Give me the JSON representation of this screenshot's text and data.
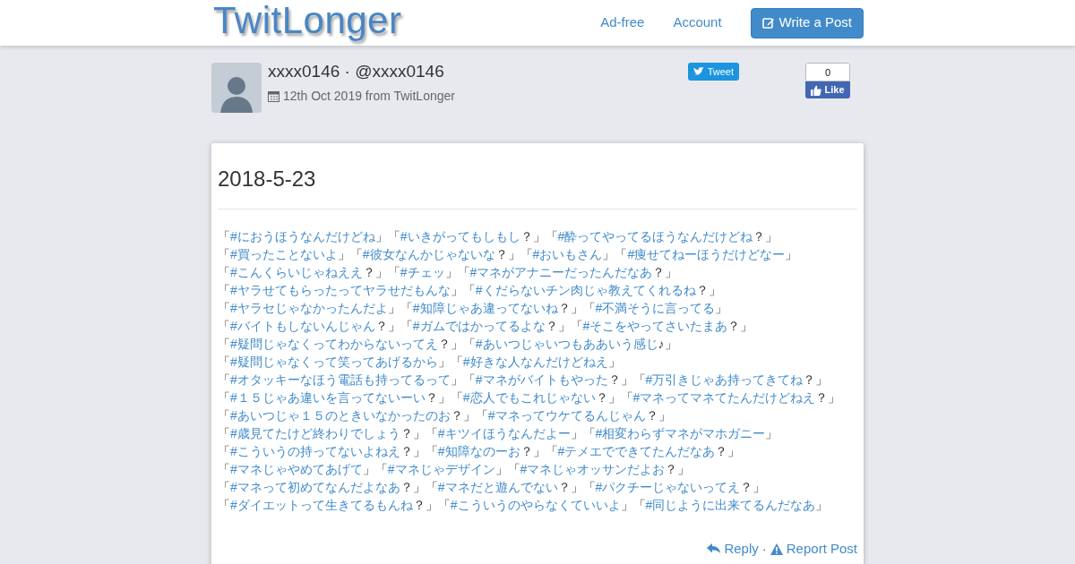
{
  "header": {
    "logo": "TwitLonger",
    "nav": [
      "Ad-free",
      "Account"
    ],
    "write_button": "Write a Post"
  },
  "author": {
    "name": "xxxx0146 · @xxxx0146",
    "date": "12th Oct 2019 from TwitLonger"
  },
  "share": {
    "tweet": "Tweet",
    "like_count": "0",
    "like": "Like"
  },
  "post": {
    "title": "2018-5-23",
    "items": [
      {
        "open": "「",
        "tag": "#におうほうなんだけどね",
        "close": "」"
      },
      {
        "open": "「",
        "tag": "#いきがってもしもし",
        "close": "？」"
      },
      {
        "open": "「",
        "tag": "#酔ってやってるほうなんだけどね",
        "close": "？」"
      },
      {
        "open": "「",
        "tag": "#買ったことないよ",
        "close": "」"
      },
      {
        "open": "「",
        "tag": "#彼女なんかじゃないな",
        "close": "？」"
      },
      {
        "open": "「",
        "tag": "#おいもさん",
        "close": "」"
      },
      {
        "open": "「",
        "tag": "#痩せてねーほうだけどなー",
        "close": "」"
      },
      {
        "open": "「",
        "tag": "#こんくらいじゃねええ",
        "close": "？」"
      },
      {
        "open": "「",
        "tag": "#チェッ",
        "close": "」"
      },
      {
        "open": "「",
        "tag": "#マネがアナニーだったんだなあ",
        "close": "？」"
      },
      {
        "open": "「",
        "tag": "#ヤラせてもらったってヤラせだもんな",
        "close": "」"
      },
      {
        "open": "「",
        "tag": "#くだらないチン肉じゃ教えてくれるね",
        "close": "？」"
      },
      {
        "open": "「",
        "tag": "#ヤラセじゃなかったんだよ",
        "close": "」"
      },
      {
        "open": "「",
        "tag": "#知障じゃあ違ってないね",
        "close": "？」"
      },
      {
        "open": "「",
        "tag": "#不満そうに言ってる",
        "close": "」"
      },
      {
        "open": "「",
        "tag": "#バイトもしないんじゃん",
        "close": "？」"
      },
      {
        "open": "「",
        "tag": "#ガムではかってるよな",
        "close": "？」"
      },
      {
        "open": "「",
        "tag": "#そこをやってさいたまあ",
        "close": "？」"
      },
      {
        "open": "「",
        "tag": "#疑問じゃなくってわからないってえ",
        "close": "？」"
      },
      {
        "open": "「",
        "tag": "#あいつじゃいつもああいう感じ",
        "close": "♪」"
      },
      {
        "open": "「",
        "tag": "#疑問じゃなくって笑ってあげるから",
        "close": "」"
      },
      {
        "open": "「",
        "tag": "#好きな人なんだけどねえ",
        "close": "」"
      },
      {
        "open": "「",
        "tag": "#オタッキーなほう電話も持ってるって",
        "close": "」"
      },
      {
        "open": "「",
        "tag": "#マネがバイトもやった",
        "close": "？」"
      },
      {
        "open": "「",
        "tag": "#万引きじゃあ持ってきてね",
        "close": "？」"
      },
      {
        "open": "「",
        "tag": "#１５じゃあ違いを言ってないーい",
        "close": "？」"
      },
      {
        "open": "「",
        "tag": "#恋人でもこれじゃない",
        "close": "？」"
      },
      {
        "open": "「",
        "tag": "#マネってマネてたんだけどねえ",
        "close": "？」"
      },
      {
        "open": "「",
        "tag": "#あいつじゃ１５のときいなかったのお",
        "close": "？」"
      },
      {
        "open": "「",
        "tag": "#マネってウケてるんじゃん",
        "close": "？」"
      },
      {
        "open": "「",
        "tag": "#歳見てたけど終わりでしょう",
        "close": "？」"
      },
      {
        "open": "「",
        "tag": "#キツイほうなんだよー",
        "close": "」"
      },
      {
        "open": "「",
        "tag": "#相変わらずマネがマホガニー",
        "close": "」"
      },
      {
        "open": "「",
        "tag": "#こういうの持ってないよねえ",
        "close": "？」"
      },
      {
        "open": "「",
        "tag": "#知障なのーお",
        "close": "？」"
      },
      {
        "open": "「",
        "tag": "#テメエでできてたんだなあ",
        "close": "？」"
      },
      {
        "open": "「",
        "tag": "#マネじゃやめてあげて",
        "close": "」"
      },
      {
        "open": "「",
        "tag": "#マネじゃデザイン",
        "close": "」"
      },
      {
        "open": "「",
        "tag": "#マネじゃオッサンだよお",
        "close": "？」"
      },
      {
        "open": "「",
        "tag": "#マネって初めてなんだよなあ",
        "close": "？」"
      },
      {
        "open": "「",
        "tag": "#マネだと遊んでない",
        "close": "？」"
      },
      {
        "open": "「",
        "tag": "#パクチーじゃないってえ",
        "close": "？」"
      },
      {
        "open": "「",
        "tag": "#ダイエットって生きてるもんね",
        "close": "？」"
      },
      {
        "open": "「",
        "tag": "#こういうのやらなくていいよ",
        "close": "」"
      },
      {
        "open": "「",
        "tag": "#同じように出来てるんだなあ",
        "close": "」"
      }
    ],
    "reply": "Reply",
    "separator": "·",
    "report": "Report Post"
  }
}
